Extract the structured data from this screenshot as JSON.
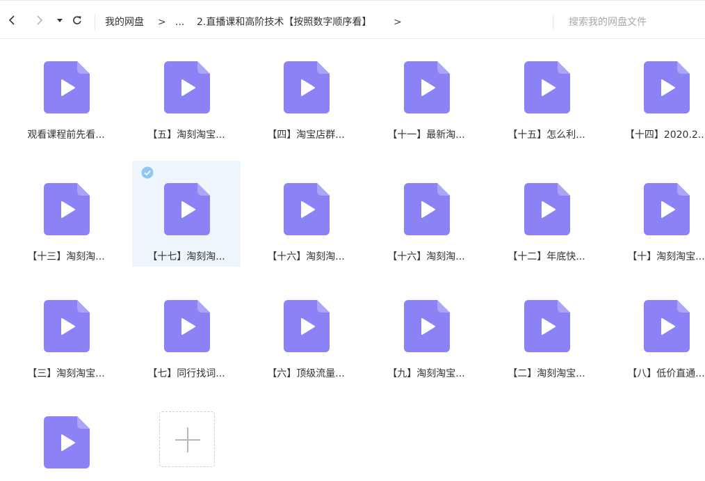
{
  "toolbar": {
    "breadcrumb": {
      "root": "我的网盘",
      "sep1": ">",
      "ellipsis": "...",
      "current": "2.直播课和高阶技术【按照数字顺序看】",
      "sep2": ">"
    },
    "search_placeholder": "搜索我的网盘文件"
  },
  "files": [
    {
      "name": "观看课程前先看..."
    },
    {
      "name": "【五】淘刻淘宝..."
    },
    {
      "name": "【四】淘宝店群..."
    },
    {
      "name": "【十一】最新淘..."
    },
    {
      "name": "【十五】怎么利..."
    },
    {
      "name": "【十四】2020.2..."
    },
    {
      "name": "【十三】淘刻淘..."
    },
    {
      "name": "【十七】淘刻淘...",
      "selected": true
    },
    {
      "name": "【十六】淘刻淘..."
    },
    {
      "name": "【十六】淘刻淘..."
    },
    {
      "name": "【十二】年底快..."
    },
    {
      "name": "【十】淘刻淘宝..."
    },
    {
      "name": "【三】淘刻淘宝..."
    },
    {
      "name": "【七】同行找词..."
    },
    {
      "name": "【六】顶级流量..."
    },
    {
      "name": "【九】淘刻淘宝..."
    },
    {
      "name": "【二】淘刻淘宝..."
    },
    {
      "name": "【八】低价直通..."
    },
    {
      "name": ""
    }
  ],
  "colors": {
    "file_icon": "#8b83f5",
    "file_icon_fold": "#aba5f8",
    "selected_bg": "#eef6fd",
    "check_badge": "#8fc8f3"
  },
  "icons": {
    "back": "chevron-left-icon",
    "forward": "chevron-right-icon",
    "history": "caret-down-icon",
    "refresh": "refresh-icon",
    "file": "video-file-icon",
    "new": "plus-icon"
  }
}
